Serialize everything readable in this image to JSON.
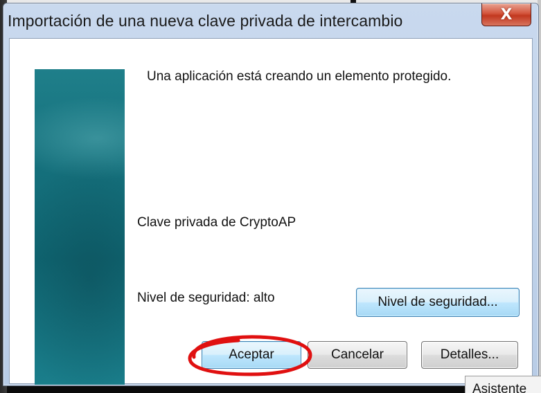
{
  "dialog": {
    "title": "Importación de una nueva clave privada de intercambio",
    "close_symbol": "X",
    "message": "Una aplicación está creando un elemento protegido.",
    "key_name": "Clave privada de CryptoAP",
    "security_level": "Nivel de seguridad: alto",
    "buttons": {
      "security": "Nivel de seguridad...",
      "ok": "Aceptar",
      "cancel": "Cancelar",
      "details": "Detalles..."
    },
    "highlight_color": "#e01010"
  },
  "background": {
    "tooltip_text": "Asistente"
  },
  "colors": {
    "banner": "#16727e",
    "titlebar": "#c9d9ee",
    "close_button": "#c9452c"
  }
}
